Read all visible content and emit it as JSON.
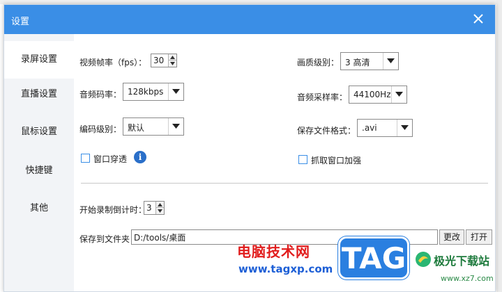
{
  "window": {
    "title": "设置"
  },
  "sidebar": {
    "items": [
      {
        "label": "录屏设置",
        "active": true
      },
      {
        "label": "直播设置",
        "active": false
      },
      {
        "label": "鼠标设置",
        "active": false
      },
      {
        "label": "快捷键",
        "active": false
      },
      {
        "label": "其他",
        "active": false
      }
    ]
  },
  "settings": {
    "fps_label": "视频帧率（fps）：",
    "fps_value": "30",
    "quality_label": "画质级别：",
    "quality_value": "3 高清",
    "audio_bitrate_label": "音频码率：",
    "audio_bitrate_value": "128kbps",
    "sample_rate_label": "音频采样率：",
    "sample_rate_value": "44100Hz",
    "encode_level_label": "编码级别：",
    "encode_level_value": "默认",
    "format_label": "保存文件格式：",
    "format_value": ".avi",
    "window_through_label": "窗口穿透",
    "window_through_checked": false,
    "capture_enhance_label": "抓取窗口加强",
    "capture_enhance_checked": false,
    "info_icon_glyph": "i"
  },
  "recording": {
    "countdown_label": "开始录制倒计时：",
    "countdown_value": "3",
    "save_folder_label": "保存到文件夹：",
    "save_folder_value": "D:/tools/桌面",
    "change_button": "更改",
    "open_button": "打开"
  },
  "watermark": {
    "site_name": "电脑技术网",
    "site_url": "www.tagxp.com",
    "tag_text": "TAG",
    "brand_name": "极光下载站",
    "brand_url": "www.xz7.com"
  },
  "colors": {
    "titlebar": "#3a8ee6",
    "sidebar_bg": "#f2f4f7",
    "checkbox_border": "#3a8ee6",
    "info_icon": "#2a6fc9"
  }
}
